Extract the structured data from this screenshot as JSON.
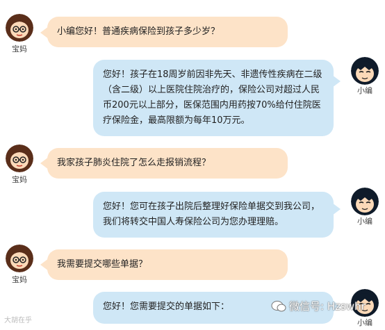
{
  "labels": {
    "mom": "宝妈",
    "editor": "小编"
  },
  "messages": [
    {
      "speaker": "mom",
      "text": "小编您好！普通疾病保险到孩子多少岁？"
    },
    {
      "speaker": "editor",
      "text": "您好！孩子在18周岁前因非先天、非遗传性疾病在二级（含二级）以上医院住院治疗的，保险公司对超过人民币200元以上部分，医保范围内用药按70%给付住院医疗保险金，最高限额为每年10万元。"
    },
    {
      "speaker": "mom",
      "text": "我家孩子肺炎住院了怎么走报销流程？"
    },
    {
      "speaker": "editor",
      "text": "您好！您可在孩子出院后整理好保险单据交到我公司，我们将转交中国人寿保险公司为您办理理赔。"
    },
    {
      "speaker": "mom",
      "text": "我需要提交哪些单据？"
    },
    {
      "speaker": "editor",
      "text": "您好！您需要提交的单据如下："
    }
  ],
  "watermark": "微信号: Hzswhr",
  "corner_logo": "大胡在乎",
  "colors": {
    "mom_bubble": "#fde3c8",
    "editor_bubble": "#cfe7f6"
  }
}
